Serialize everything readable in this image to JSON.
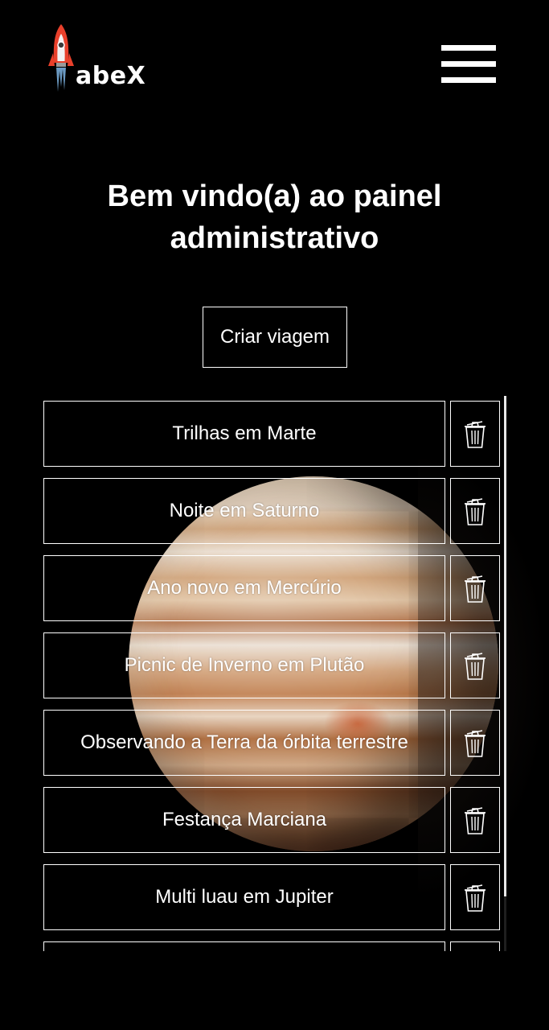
{
  "header": {
    "logo_text": "abeX",
    "menu_icon": "hamburger-menu-icon"
  },
  "main": {
    "title_line1": "Bem vindo(a) ao painel",
    "title_line2": "administrativo",
    "create_button": "Criar viagem"
  },
  "trips": [
    {
      "name": "Trilhas em Marte"
    },
    {
      "name": "Noite em Saturno"
    },
    {
      "name": "Ano novo em Mercúrio"
    },
    {
      "name": "Picnic de Inverno em Plutão"
    },
    {
      "name": "Observando a Terra da órbita terrestre"
    },
    {
      "name": "Festança Marciana"
    },
    {
      "name": "Multi luau em Jupiter"
    },
    {
      "name": ""
    }
  ],
  "icons": {
    "delete": "trash-icon",
    "logo": "rocket-icon"
  },
  "colors": {
    "background": "#000000",
    "foreground": "#ffffff",
    "rocket_accent": "#e8402b"
  }
}
